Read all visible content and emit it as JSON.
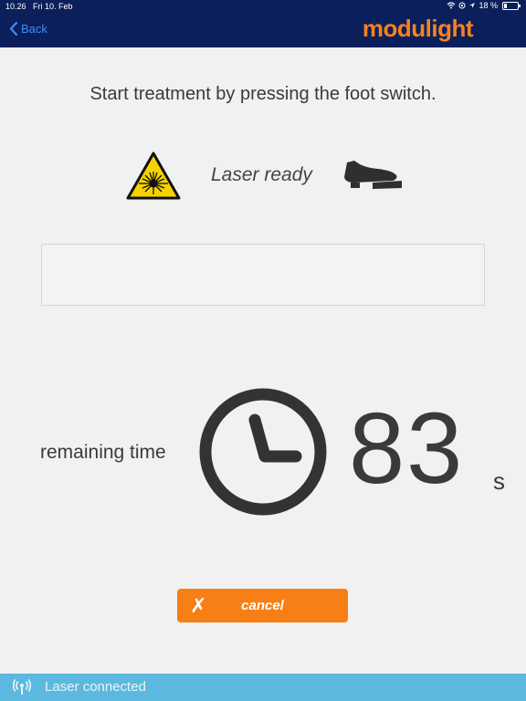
{
  "status_bar": {
    "time": "10.26",
    "date": "Fri 10. Feb",
    "battery": "18 %",
    "battery_level": 0.18
  },
  "nav": {
    "back_label": "Back",
    "brand": "modulight"
  },
  "main": {
    "instruction": "Start treatment by pressing the foot switch.",
    "laser_status": "Laser ready",
    "message_text": "",
    "remaining_label": "remaining time",
    "timer_value": "83",
    "timer_unit": "s",
    "cancel_label": "cancel"
  },
  "footer": {
    "connection_status": "Laser connected"
  },
  "colors": {
    "header_bg": "#0b1f5b",
    "brand": "#f5821f",
    "back_link": "#3d8ef7",
    "cancel_button": "#f77f15",
    "footer_bg": "#5cb8de",
    "warning_yellow": "#f6d200"
  },
  "icons": {
    "back": "chevron-left-icon",
    "laser": "laser-warning-icon",
    "foot_switch": "foot-switch-icon",
    "timer": "clock-icon",
    "cancel": "x-icon",
    "connection": "wireless-signal-icon",
    "wifi": "wifi-icon",
    "location": "location-icon",
    "battery": "battery-icon"
  }
}
